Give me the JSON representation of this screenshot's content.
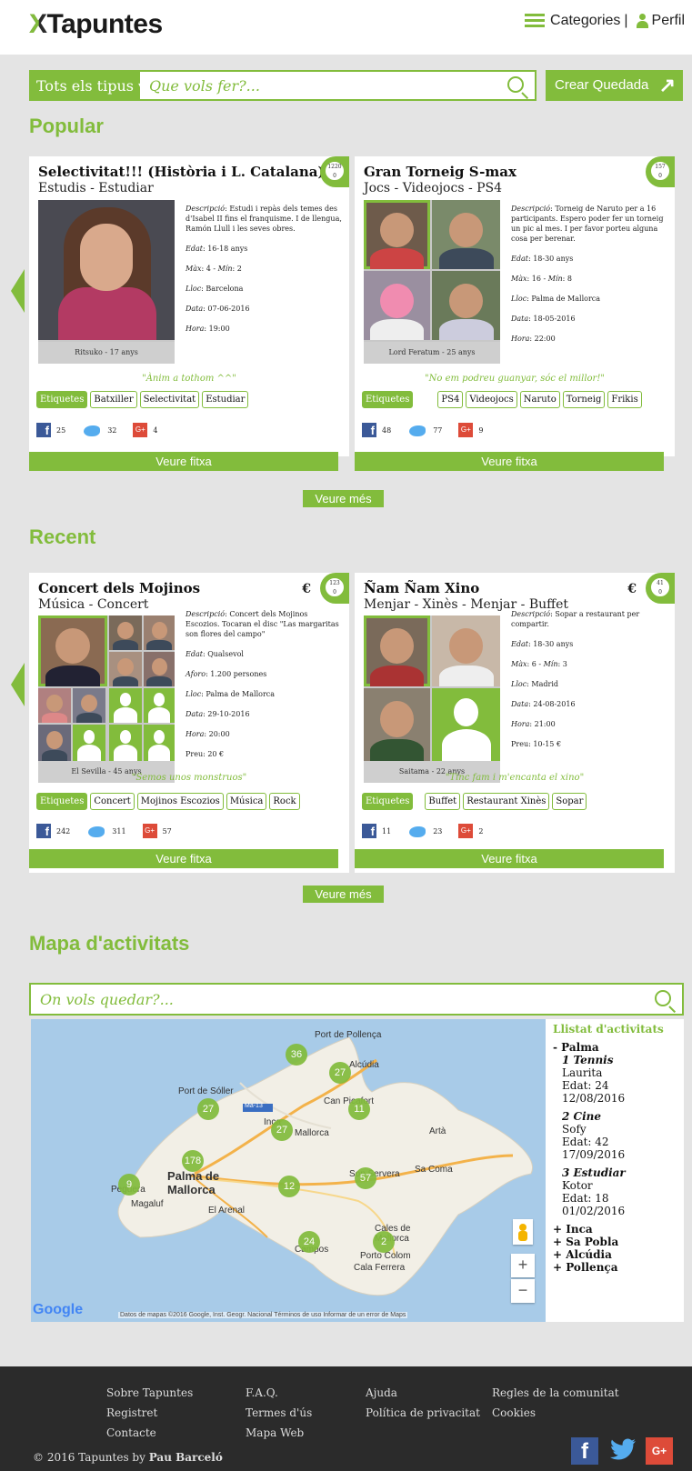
{
  "header": {
    "logo": "Tapuntes",
    "categories": "Categories",
    "separator": "|",
    "profile": "Perfil"
  },
  "search": {
    "type_label": "Tots els tipus ▾",
    "placeholder": "Que vols fer?...",
    "create": "Crear Quedada"
  },
  "popular": {
    "title": "Popular",
    "cards": [
      {
        "title": "Selectivitat!!! (Història i L. Catalana)",
        "subtitle": "Estudis - Estudiar",
        "badge_top": "1220",
        "badge_bottom": "0",
        "caption": "Ritsuko - 17 anys",
        "desc_label": "Descripció",
        "desc": ": Estudi i repàs dels temes des d'Isabel II fins el franquisme. I de llengua, Ramón Llull i les seves obres.",
        "edat_label": "Edat",
        "edat": ": 16-18 anys",
        "max_label": "Màx",
        "max": ": 4 - ",
        "min_label": "Mín",
        "min": ": 2",
        "lloc_label": "Lloc",
        "lloc": ": Barcelona",
        "data_label": "Data",
        "data": ": 07-06-2016",
        "hora_label": "Hora",
        "hora": ": 19:00",
        "quote": "\"Ànim a tothom ^^\"",
        "tags_label": "Etiquetes",
        "tags": [
          "Batxiller",
          "Selectivitat",
          "Estudiar"
        ],
        "fb": "25",
        "tw": "32",
        "gp": "4",
        "gp_icon": "G+",
        "button": "Veure fitxa"
      },
      {
        "title": "Gran Torneig S-max",
        "subtitle": "Jocs - Videojocs - PS4",
        "badge_top": "157",
        "badge_bottom": "0",
        "caption": "Lord Feratum - 25 anys",
        "desc_label": "Descripció",
        "desc": ": Torneig de Naruto per a 16 participants. Espero poder fer un torneig un pic al mes. I per favor porteu alguna cosa per berenar.",
        "edat_label": "Edat",
        "edat": ": 18-30 anys",
        "max_label": "Màx",
        "max": ": 16 - ",
        "min_label": "Mín",
        "min": ": 8",
        "lloc_label": "Lloc",
        "lloc": ": Palma de Mallorca",
        "data_label": "Data",
        "data": ": 18-05-2016",
        "hora_label": "Hora",
        "hora": ": 22:00",
        "quote": "\"No em podreu guanyar, sóc el millor!\"",
        "tags_label": "Etiquetes",
        "tags": [
          "PS4",
          "Videojocs",
          "Naruto",
          "Torneig",
          "Frikis"
        ],
        "fb": "48",
        "tw": "77",
        "gp": "9",
        "gp_icon": "G+",
        "button": "Veure fitxa"
      }
    ],
    "more": "Veure més"
  },
  "recent": {
    "title": "Recent",
    "cards": [
      {
        "title": "Concert dels Mojinos",
        "subtitle": "Música - Concert",
        "euro": "€",
        "badge_top": "123",
        "badge_bottom": "0",
        "caption": "El Sevilla - 45 anys",
        "desc_label": "Descripció",
        "desc": ": Concert dels Mojinos Escozios. Tocaran el disc \"Las margaritas son flores del campo\"",
        "edat_label": "Edat",
        "edat": ": Qualsevol",
        "aforo_label": "Aforo",
        "aforo": ": 1.200 persones",
        "lloc_label": "Lloc",
        "lloc": ": Palma de Mallorca",
        "data_label": "Data",
        "data": ": 29-10-2016",
        "hora_label": "Hora",
        "hora": ": 20:00",
        "preu": "Preu: 20 €",
        "quote": "\"Semos unos monstruos\"",
        "tags_label": "Etiquetes",
        "tags": [
          "Concert",
          "Mojinos Escozios",
          "Música",
          "Rock"
        ],
        "fb": "242",
        "tw": "311",
        "gp": "57",
        "gp_icon": "G+",
        "button": "Veure fitxa"
      },
      {
        "title": "Ñam Ñam Xino",
        "subtitle": "Menjar - Xinès - Menjar - Buffet",
        "euro": "€",
        "badge_top": "41",
        "badge_bottom": "0",
        "caption": "Saitama - 22 anys",
        "desc_label": "Descripció",
        "desc": ": Sopar a restaurant per compartir.",
        "edat_label": "Edat",
        "edat": ": 18-30 anys",
        "max_label": "Màx",
        "max": ": 6 - ",
        "min_label": "Mín",
        "min": ": 3",
        "lloc_label": "Lloc",
        "lloc": ": Madrid",
        "data_label": "Data",
        "data": ": 24-08-2016",
        "hora_label": "Hora",
        "hora": ": 21:00",
        "preu": "Preu: 10-15 €",
        "quote": "\"Tinc fam i m'encanta el xino\"",
        "tags_label": "Etiquetes",
        "tags": [
          "Buffet",
          "Restaurant Xinès",
          "Sopar"
        ],
        "fb": "11",
        "tw": "23",
        "gp": "2",
        "gp_icon": "G+",
        "button": "Veure fitxa"
      }
    ],
    "more": "Veure més"
  },
  "map": {
    "title": "Mapa d'activitats",
    "placeholder": "On vols quedar?...",
    "clusters": [
      "36",
      "27",
      "27",
      "11",
      "27",
      "178",
      "9",
      "12",
      "57",
      "24",
      "2"
    ],
    "labels": [
      "Port de Pollença",
      "Alcúdia",
      "Port de Sóller",
      "Can Picafort",
      "Inca",
      "Mallorca",
      "Artà",
      "Palma de Mallorca",
      "Peguera",
      "Magaluf",
      "El Arenal",
      "Son Servera",
      "Sa Coma",
      "Cales de Mallorca",
      "Campos",
      "Porto Colom",
      "Cala Ferrera",
      "Ma-13"
    ],
    "google": "Google",
    "credits": "Datos de mapas ©2016 Google, Inst. Geogr. Nacional   Términos de uso   Informar de un error de Maps",
    "zoom_in": "+",
    "zoom_out": "−"
  },
  "list": {
    "title": "Llistat d'activitats",
    "city": "- Palma",
    "activities": [
      {
        "name": "1 Tennis",
        "who": "Laurita",
        "age": "Edat: 24",
        "date": "12/08/2016"
      },
      {
        "name": "2 Cine",
        "who": "Sofy",
        "age": "Edat: 42",
        "date": "17/09/2016"
      },
      {
        "name": "3 Estudiar",
        "who": "Kotor",
        "age": "Edat: 18",
        "date": "01/02/2016"
      }
    ],
    "other_cities": [
      "+ Inca",
      "+ Sa Pobla",
      "+ Alcúdia",
      "+ Pollença"
    ]
  },
  "footer": {
    "col1": [
      "Sobre Tapuntes",
      "Registret",
      "Contacte"
    ],
    "col2": [
      "F.A.Q.",
      "Termes d'ús",
      "Mapa Web"
    ],
    "col3": [
      "Ajuda",
      "Política de privacitat"
    ],
    "col4": [
      "Regles de la comunitat",
      "Cookies"
    ],
    "copyright_prefix": "© 2016 Tapuntes by ",
    "copyright_author": "Pau Barceló",
    "fb_icon": "f",
    "gp_icon": "G+"
  },
  "colors": {
    "accent": "#82bc3c",
    "footer": "#2b2b2b",
    "background": "#e4e4e4"
  }
}
